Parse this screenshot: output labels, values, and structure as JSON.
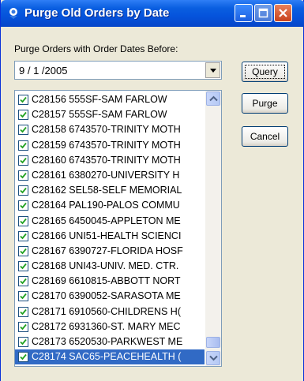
{
  "window": {
    "title": "Purge Old Orders by Date"
  },
  "filter": {
    "label": "Purge Orders with Order Dates Before:",
    "date_value": "9 / 1 /2005"
  },
  "buttons": {
    "query": "Query",
    "purge": "Purge",
    "cancel": "Cancel"
  },
  "orders": [
    {
      "text": "C28156  555SF-SAM FARLOW",
      "checked": true
    },
    {
      "text": "C28157  555SF-SAM FARLOW",
      "checked": true
    },
    {
      "text": "C28158  6743570-TRINITY MOTH",
      "checked": true
    },
    {
      "text": "C28159  6743570-TRINITY MOTH",
      "checked": true
    },
    {
      "text": "C28160  6743570-TRINITY MOTH",
      "checked": true
    },
    {
      "text": "C28161  6380270-UNIVERSITY H",
      "checked": true
    },
    {
      "text": "C28162  SEL58-SELF MEMORIAL",
      "checked": true
    },
    {
      "text": "C28164  PAL190-PALOS COMMU",
      "checked": true
    },
    {
      "text": "C28165  6450045-APPLETON ME",
      "checked": true
    },
    {
      "text": "C28166  UNI51-HEALTH SCIENCI",
      "checked": true
    },
    {
      "text": "C28167  6390727-FLORIDA HOSF",
      "checked": true
    },
    {
      "text": "C28168  UNI43-UNIV. MED. CTR.",
      "checked": true
    },
    {
      "text": "C28169  6610815-ABBOTT NORT",
      "checked": true
    },
    {
      "text": "C28170  6390052-SARASOTA ME",
      "checked": true
    },
    {
      "text": "C28171  6910560-CHILDRENS H(",
      "checked": true
    },
    {
      "text": "C28172  6931360-ST. MARY MEC",
      "checked": true
    },
    {
      "text": "C28173  6520530-PARKWEST ME",
      "checked": true
    },
    {
      "text": "C28174  SAC65-PEACEHEALTH (",
      "checked": true,
      "selected": true
    }
  ],
  "colors": {
    "titlebar": "#0553dc",
    "selection": "#316ac5",
    "dialog_bg": "#ece9d8"
  },
  "icons": {
    "title": "app-icon",
    "minimize": "minimize-icon",
    "maximize": "maximize-icon",
    "close": "close-icon",
    "combo_arrow": "chevron-down-icon",
    "scroll_up": "chevron-up-icon",
    "scroll_down": "chevron-down-icon",
    "checkbox": "checkmark-icon"
  }
}
